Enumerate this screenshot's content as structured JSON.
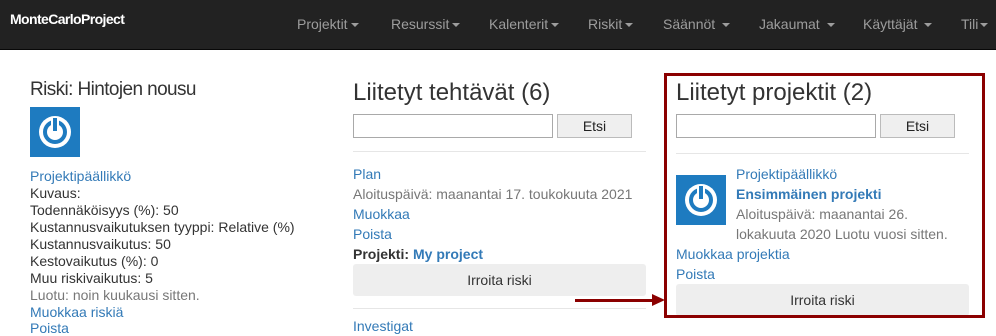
{
  "navbar": {
    "brand": "MonteCarloProject",
    "items": [
      {
        "label": "Projektit",
        "caret": true
      },
      {
        "label": "Resurssit",
        "caret": true
      },
      {
        "label": "Kalenterit",
        "caret": true
      },
      {
        "label": "Riskit",
        "caret": true
      },
      {
        "label": "Säännöt",
        "caret": true
      },
      {
        "label": "Jakaumat",
        "caret": true
      },
      {
        "label": "Käyttäjät",
        "caret": true
      },
      {
        "label": "Tili",
        "caret": true
      }
    ]
  },
  "risk": {
    "title": "Riski: Hintojen nousu",
    "role_link": "Projektipäällikkö",
    "description_label": "Kuvaus:",
    "probability": "Todennäköisyys (%): 50",
    "cost_impact_type": "Kustannusvaikutuksen tyyppi: Relative (%)",
    "cost_impact": "Kustannusvaikutus: 50",
    "duration_impact": "Kestovaikutus (%): 0",
    "other_impact": "Muu riskivaikutus: 5",
    "created": "Luotu: noin kuukausi sitten.",
    "edit_link": "Muokkaa riskiä",
    "delete_link": "Poista"
  },
  "tasks": {
    "title": "Liitetyt tehtävät (6)",
    "search_button": "Etsi",
    "search_value": "",
    "item": {
      "name": "Plan",
      "start": "Aloituspäivä: maanantai 17. toukokuuta 2021",
      "edit": "Muokkaa",
      "delete": "Poista",
      "project_label": "Projekti:",
      "project_name": "My project",
      "detach_button": "Irroita riski"
    },
    "next_item_partial": "Investigat"
  },
  "projects": {
    "title": "Liitetyt projektit (2)",
    "search_button": "Etsi",
    "search_value": "",
    "item": {
      "role_link": "Projektipäällikkö",
      "name": "Ensimmäinen projekti",
      "start_line1": "Aloituspäivä: maanantai 26.",
      "start_line2": "lokakuuta 2020 Luotu vuosi sitten.",
      "edit": "Muokkaa projektia",
      "delete": "Poista",
      "detach_button": "Irroita riski"
    }
  },
  "colors": {
    "navbar_bg": "#222222",
    "link": "#337ab7",
    "highlight": "#8b0000",
    "avatar": "#1e7bc0"
  },
  "icons": {
    "avatar": "power-icon"
  }
}
